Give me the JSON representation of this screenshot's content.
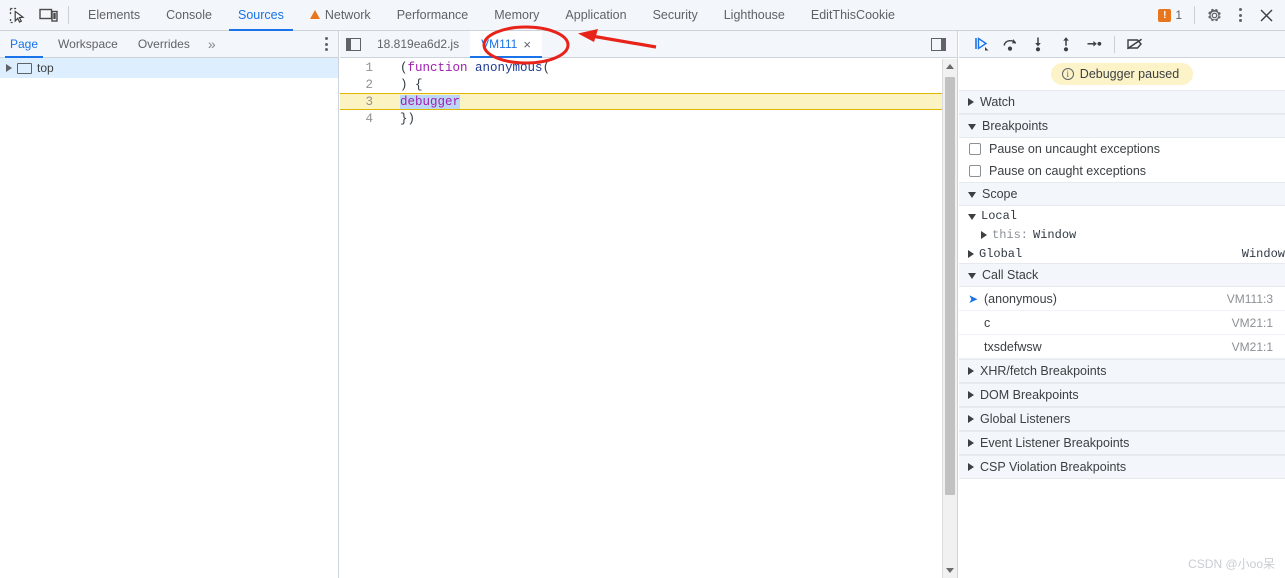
{
  "colors": {
    "accent": "#1a73e8",
    "toolbar_bg": "#f3f6fa",
    "warning_orange": "#e8761f",
    "paused_yellow": "#fdf3c8",
    "annotation_red": "#e8231a",
    "selection_blue": "#bcd6f5",
    "tree_selected": "#ddeeff"
  },
  "topbar": {
    "inspect_icon": "inspect-cursor-icon",
    "device_icon": "device-toolbar-icon",
    "tabs": [
      {
        "label": "Elements",
        "active": false,
        "warning": false
      },
      {
        "label": "Console",
        "active": false,
        "warning": false
      },
      {
        "label": "Sources",
        "active": true,
        "warning": false
      },
      {
        "label": "Network",
        "active": false,
        "warning": true
      },
      {
        "label": "Performance",
        "active": false,
        "warning": false
      },
      {
        "label": "Memory",
        "active": false,
        "warning": false
      },
      {
        "label": "Application",
        "active": false,
        "warning": false
      },
      {
        "label": "Security",
        "active": false,
        "warning": false
      },
      {
        "label": "Lighthouse",
        "active": false,
        "warning": false
      },
      {
        "label": "EditThisCookie",
        "active": false,
        "warning": false
      }
    ],
    "error_badge": {
      "icon": "error-square-icon",
      "symbol": "!",
      "count": "1"
    },
    "settings_icon": "gear-icon",
    "more_icon": "kebab-menu-icon",
    "close_icon": "close-icon"
  },
  "navigator": {
    "tabs": [
      {
        "label": "Page",
        "active": true
      },
      {
        "label": "Workspace",
        "active": false
      },
      {
        "label": "Overrides",
        "active": false
      }
    ],
    "more_tabs_icon": "chevron-double-right-icon",
    "more_icon": "kebab-menu-icon",
    "tree": [
      {
        "label": "top",
        "icon": "frame-icon",
        "selected": true,
        "expandable": true
      }
    ]
  },
  "editor": {
    "panel_toggle_left_icon": "show-navigator-icon",
    "panel_toggle_right_icon": "show-debugger-icon",
    "tabs": [
      {
        "label": "18.819ea6d2.js",
        "active": false,
        "closable": false
      },
      {
        "label": "VM111",
        "active": true,
        "closable": true,
        "close_label": "×"
      }
    ],
    "code": [
      {
        "number": "1",
        "paused": false,
        "tokens": [
          {
            "text": "(",
            "cls": ""
          },
          {
            "text": "function",
            "cls": "kw"
          },
          {
            "text": " ",
            "cls": ""
          },
          {
            "text": "anonymous",
            "cls": "fn"
          },
          {
            "text": "(",
            "cls": ""
          }
        ]
      },
      {
        "number": "2",
        "paused": false,
        "tokens": [
          {
            "text": ") {",
            "cls": ""
          }
        ]
      },
      {
        "number": "3",
        "paused": true,
        "tokens": [
          {
            "text": "debugger",
            "cls": "kw sel"
          }
        ]
      },
      {
        "number": "4",
        "paused": false,
        "tokens": [
          {
            "text": "})",
            "cls": ""
          }
        ]
      }
    ],
    "scrollbar": {
      "up_icon": "scroll-up-arrow-icon",
      "down_icon": "scroll-down-arrow-icon",
      "thumb": "scrollbar-thumb"
    }
  },
  "debugger": {
    "controls": [
      {
        "name": "resume-script-execution-button",
        "icon": "resume-icon"
      },
      {
        "name": "step-over-button",
        "icon": "step-over-icon"
      },
      {
        "name": "step-into-button",
        "icon": "step-into-icon"
      },
      {
        "name": "step-out-button",
        "icon": "step-out-icon"
      },
      {
        "name": "step-button",
        "icon": "step-icon"
      },
      {
        "name": "deactivate-breakpoints-button",
        "icon": "deactivate-breakpoints-icon"
      }
    ],
    "paused_banner": {
      "icon": "info-icon",
      "label": "Debugger paused"
    },
    "sections": {
      "watch": {
        "label": "Watch",
        "expanded": false
      },
      "breakpoints": {
        "label": "Breakpoints",
        "expanded": true,
        "checkboxes": [
          {
            "label": "Pause on uncaught exceptions",
            "checked": false
          },
          {
            "label": "Pause on caught exceptions",
            "checked": false
          }
        ]
      },
      "scope": {
        "label": "Scope",
        "expanded": true,
        "entries": [
          {
            "label": "Local",
            "expanded": true,
            "indent": false,
            "value": ""
          },
          {
            "label": "this:",
            "dim_label": true,
            "value_inline": "Window",
            "expanded": false,
            "indent": true
          },
          {
            "label": "Global",
            "expanded": false,
            "indent": false,
            "value": "Window"
          }
        ]
      },
      "call_stack": {
        "label": "Call Stack",
        "expanded": true,
        "frames": [
          {
            "name": "(anonymous)",
            "location": "VM111:3",
            "selected": true
          },
          {
            "name": "c",
            "location": "VM21:1",
            "selected": false
          },
          {
            "name": "txsdefwsw",
            "location": "VM21:1",
            "selected": false
          }
        ]
      },
      "collapsed": [
        {
          "label": "XHR/fetch Breakpoints",
          "expanded": false
        },
        {
          "label": "DOM Breakpoints",
          "expanded": false
        },
        {
          "label": "Global Listeners",
          "expanded": false
        },
        {
          "label": "Event Listener Breakpoints",
          "expanded": false
        },
        {
          "label": "CSP Violation Breakpoints",
          "expanded": false
        }
      ]
    }
  },
  "annotations": {
    "ellipse_target": "VM111 tab",
    "arrow_direction": "left",
    "color": "#e8231a"
  },
  "watermark": "CSDN @小oo呆"
}
